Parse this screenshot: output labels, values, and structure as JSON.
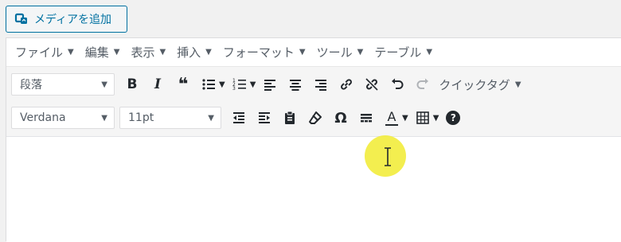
{
  "media": {
    "add_media_label": "メディアを追加"
  },
  "menubar": {
    "items": [
      {
        "label": "ファイル"
      },
      {
        "label": "編集"
      },
      {
        "label": "表示"
      },
      {
        "label": "挿入"
      },
      {
        "label": "フォーマット"
      },
      {
        "label": "ツール"
      },
      {
        "label": "テーブル"
      }
    ]
  },
  "toolbar": {
    "format_select": "段落",
    "font_select": "Verdana",
    "size_select": "11pt",
    "quicktag_label": "クイックタグ",
    "italic_glyph": "I",
    "bold_glyph": "B",
    "omega_glyph": "Ω",
    "textcolor_glyph": "A",
    "help_glyph": "?",
    "quote_glyph": "❝"
  },
  "colors": {
    "accent": "#0071a1",
    "cursor_highlight": "#f2ec3c"
  }
}
